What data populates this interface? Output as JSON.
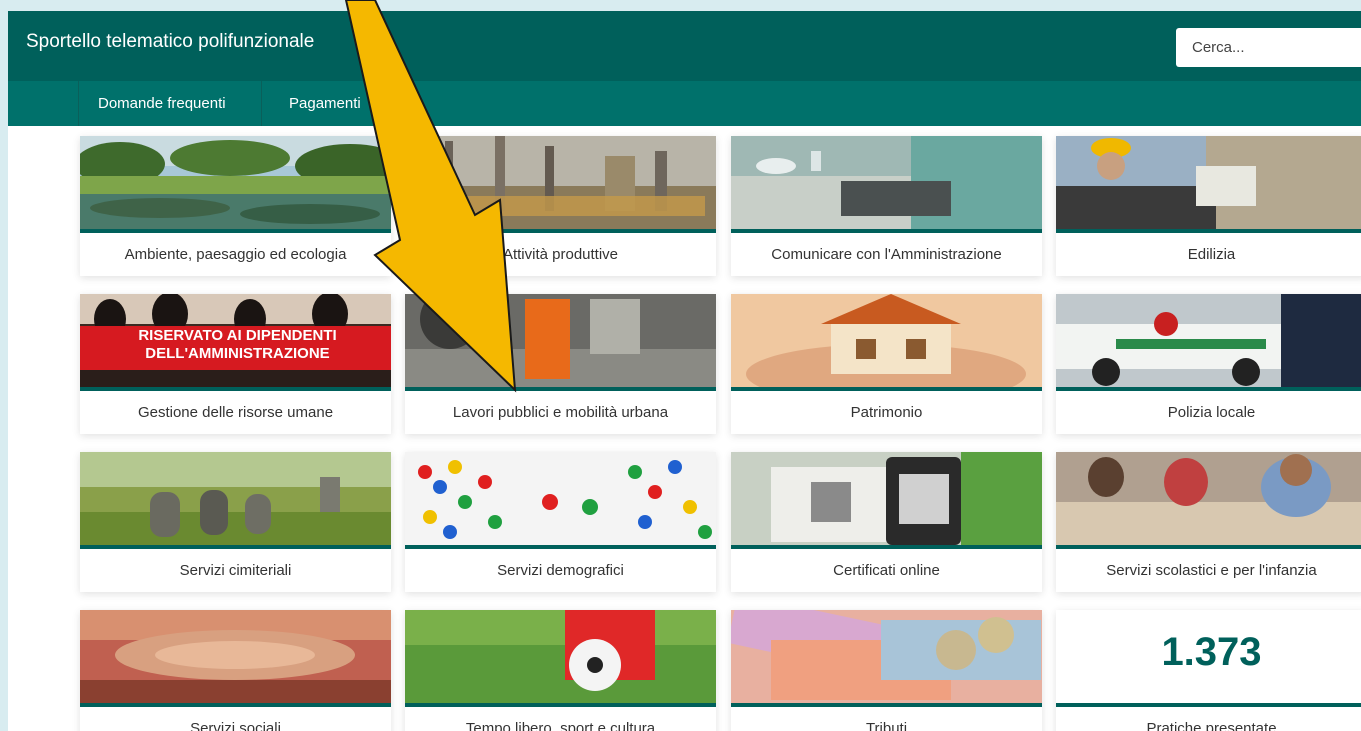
{
  "header": {
    "title": "Sportello telematico polifunzionale",
    "search_placeholder": "Cerca..."
  },
  "nav": {
    "items": [
      {
        "label": "Domande frequenti"
      },
      {
        "label": "Pagamenti"
      }
    ]
  },
  "cards": [
    {
      "label": "Ambiente, paesaggio ed ecologia"
    },
    {
      "label": "Attività produttive"
    },
    {
      "label": "Comunicare con l'Amministrazione"
    },
    {
      "label": "Edilizia"
    },
    {
      "label": "Gestione delle risorse umane",
      "banner": "RISERVATO AI DIPENDENTI DELL'AMMINISTRAZIONE"
    },
    {
      "label": "Lavori pubblici e mobilità urbana"
    },
    {
      "label": "Patrimonio"
    },
    {
      "label": "Polizia locale"
    },
    {
      "label": "Servizi cimiteriali"
    },
    {
      "label": "Servizi demografici"
    },
    {
      "label": "Certificati online"
    },
    {
      "label": "Servizi scolastici e per l'infanzia"
    },
    {
      "label": "Servizi sociali"
    },
    {
      "label": "Tempo libero, sport e cultura"
    },
    {
      "label": "Tributi"
    }
  ],
  "stat": {
    "value": "1.373",
    "label": "Pratiche presentate"
  },
  "colors": {
    "primary": "#00605b",
    "nav": "#00716b",
    "annotation_arrow": "#f5b800"
  }
}
